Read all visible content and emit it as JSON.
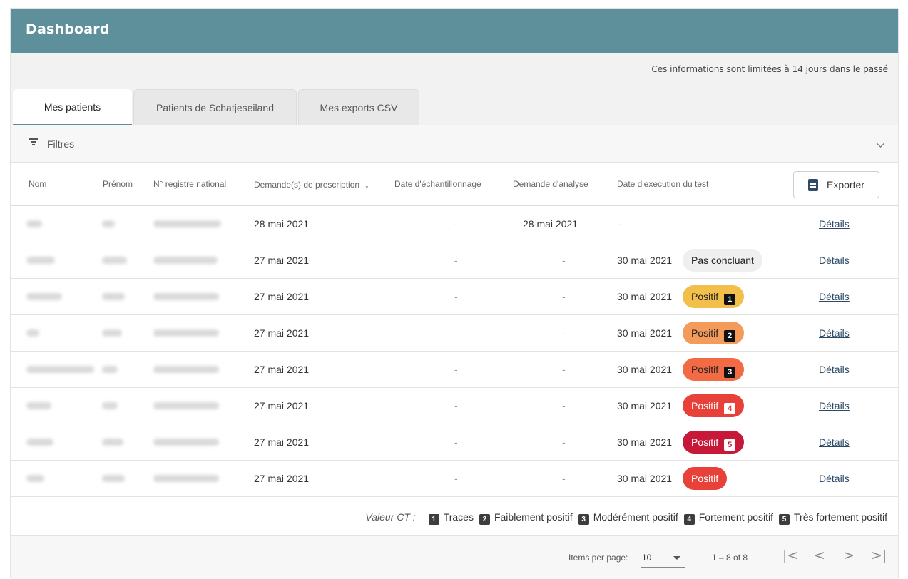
{
  "header": {
    "title": "Dashboard"
  },
  "info": "Ces informations sont limitées à 14 jours dans le passé",
  "tabs": [
    {
      "label": "Mes patients",
      "active": true
    },
    {
      "label": "Patients de Schatjeseiland",
      "active": false
    },
    {
      "label": "Mes exports CSV",
      "active": false
    }
  ],
  "filters": {
    "label": "Filtres",
    "icon": "filter-icon",
    "expand_icon": "chevron-down-icon"
  },
  "table": {
    "columns": {
      "nom": "Nom",
      "prenom": "Prénom",
      "registre": "N° registre national",
      "prescription": "Demande(s) de prescription",
      "echantillonnage": "Date d'échantillonnage",
      "analyse": "Demande d'analyse",
      "execution": "Date d'execution du test"
    },
    "sort_icon": "arrow-down-icon",
    "export_label": "Exporter",
    "rows": [
      {
        "prescription": "28 mai 2021",
        "echantillonnage": "-",
        "analyse": "28 mai 2021",
        "execution": "-",
        "result": "",
        "ct": "",
        "details": "Détails"
      },
      {
        "prescription": "27 mai 2021",
        "echantillonnage": "-",
        "analyse": "-",
        "execution": "30 mai 2021",
        "result": "Pas concluant",
        "ct": "",
        "details": "Détails"
      },
      {
        "prescription": "27 mai 2021",
        "echantillonnage": "-",
        "analyse": "-",
        "execution": "30 mai 2021",
        "result": "Positif",
        "ct": "1",
        "details": "Détails"
      },
      {
        "prescription": "27 mai 2021",
        "echantillonnage": "-",
        "analyse": "-",
        "execution": "30 mai 2021",
        "result": "Positif",
        "ct": "2",
        "details": "Détails"
      },
      {
        "prescription": "27 mai 2021",
        "echantillonnage": "-",
        "analyse": "-",
        "execution": "30 mai 2021",
        "result": "Positif",
        "ct": "3",
        "details": "Détails"
      },
      {
        "prescription": "27 mai 2021",
        "echantillonnage": "-",
        "analyse": "-",
        "execution": "30 mai 2021",
        "result": "Positif",
        "ct": "4",
        "details": "Détails"
      },
      {
        "prescription": "27 mai 2021",
        "echantillonnage": "-",
        "analyse": "-",
        "execution": "30 mai 2021",
        "result": "Positif",
        "ct": "5",
        "details": "Détails"
      },
      {
        "prescription": "27 mai 2021",
        "echantillonnage": "-",
        "analyse": "-",
        "execution": "30 mai 2021",
        "result": "Positif",
        "ct": "",
        "details": "Détails"
      }
    ]
  },
  "badge_colors": {
    "neutral": "#efefef",
    "ct1": "#f2c04a",
    "ct2": "#f49a5b",
    "ct3": "#f26b45",
    "ct4": "#e8413a",
    "ct5": "#c8183a",
    "plain": "#e8413a"
  },
  "legend": {
    "title": "Valeur CT :",
    "items": [
      {
        "num": "1",
        "label": "Traces"
      },
      {
        "num": "2",
        "label": "Faiblement positif"
      },
      {
        "num": "3",
        "label": "Modérément positif"
      },
      {
        "num": "4",
        "label": "Fortement positif"
      },
      {
        "num": "5",
        "label": "Très fortement positif"
      }
    ]
  },
  "pagination": {
    "items_per_page_label": "Items per page:",
    "items_per_page": "10",
    "range": "1 – 8 of 8",
    "first": "|<",
    "prev": "<",
    "next": ">",
    "last": ">|"
  }
}
